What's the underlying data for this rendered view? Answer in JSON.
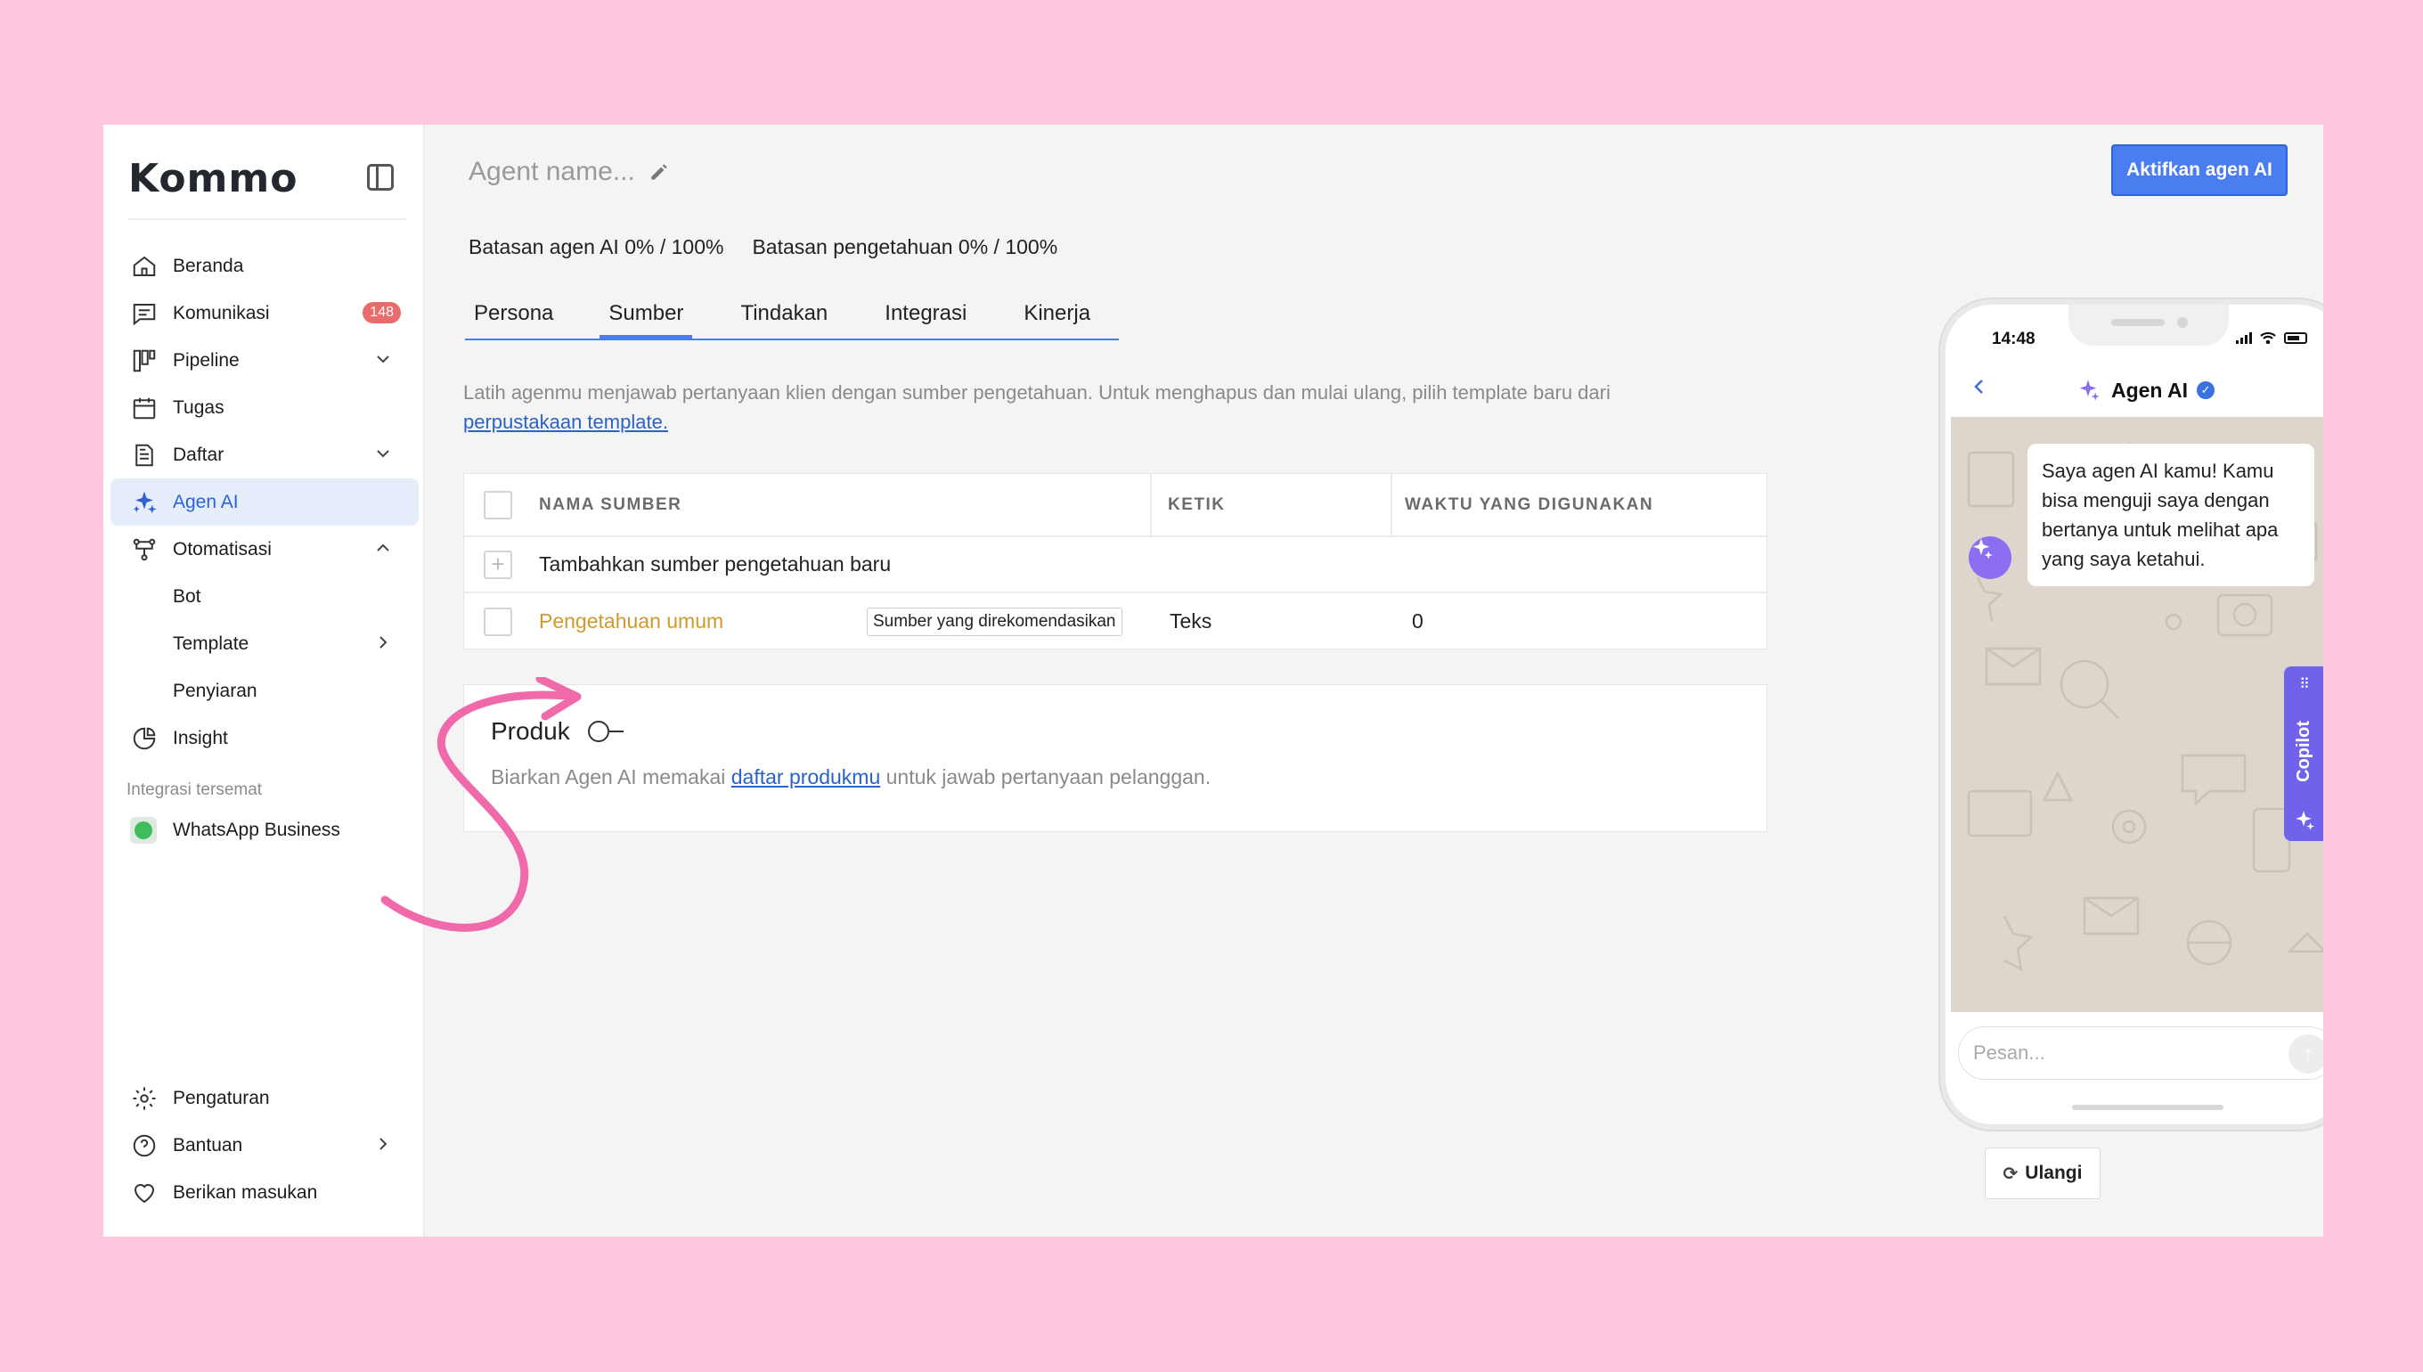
{
  "app": {
    "logo": "Kommo"
  },
  "sidebar": {
    "items": [
      {
        "label": "Beranda"
      },
      {
        "label": "Komunikasi",
        "badge": "148"
      },
      {
        "label": "Pipeline"
      },
      {
        "label": "Tugas"
      },
      {
        "label": "Daftar"
      },
      {
        "label": "Agen AI"
      },
      {
        "label": "Otomatisasi"
      },
      {
        "label": "Bot"
      },
      {
        "label": "Template"
      },
      {
        "label": "Penyiaran"
      },
      {
        "label": "Insight"
      }
    ],
    "pinned_label": "Integrasi tersemat",
    "pinned": [
      {
        "label": "WhatsApp Business"
      }
    ],
    "bottom": [
      {
        "label": "Pengaturan"
      },
      {
        "label": "Bantuan"
      },
      {
        "label": "Berikan masukan"
      }
    ]
  },
  "header": {
    "agent_name_placeholder": "Agent name...",
    "activate_button": "Aktifkan agen AI",
    "limit_agent": "Batasan agen AI 0% / 100%",
    "limit_knowledge": "Batasan pengetahuan 0% / 100%"
  },
  "tabs": [
    {
      "label": "Persona"
    },
    {
      "label": "Sumber"
    },
    {
      "label": "Tindakan"
    },
    {
      "label": "Integrasi"
    },
    {
      "label": "Kinerja"
    }
  ],
  "description": {
    "text": "Latih agenmu menjawab pertanyaan klien dengan sumber pengetahuan. Untuk menghapus dan mulai ulang, pilih template baru dari ",
    "link": "perpustakaan template."
  },
  "sources_table": {
    "headers": {
      "name": "NAMA SUMBER",
      "type": "KETIK",
      "time": "WAKTU YANG DIGUNAKAN"
    },
    "add_row": "Tambahkan sumber pengetahuan baru",
    "rows": [
      {
        "name": "Pengetahuan umum",
        "badge": "Sumber yang direkomendasikan",
        "type": "Teks",
        "time": "0"
      }
    ]
  },
  "product": {
    "title": "Produk",
    "desc_before": "Biarkan Agen AI memakai ",
    "desc_link": "daftar produkmu",
    "desc_after": " untuk jawab pertanyaan pelanggan."
  },
  "phone": {
    "time": "14:48",
    "title": "Agen AI",
    "message": "Saya agen AI kamu! Kamu bisa menguji saya dengan bertanya untuk melihat apa yang saya ketahui.",
    "input_placeholder": "Pesan..."
  },
  "retry_button": "Ulangi",
  "copilot_label": "Copilot",
  "colors": {
    "accent": "#4a7ef0",
    "badge": "#e96b6b",
    "source_name": "#cf9a2b",
    "background": "#ffc8df",
    "arrow": "#f06aab"
  }
}
